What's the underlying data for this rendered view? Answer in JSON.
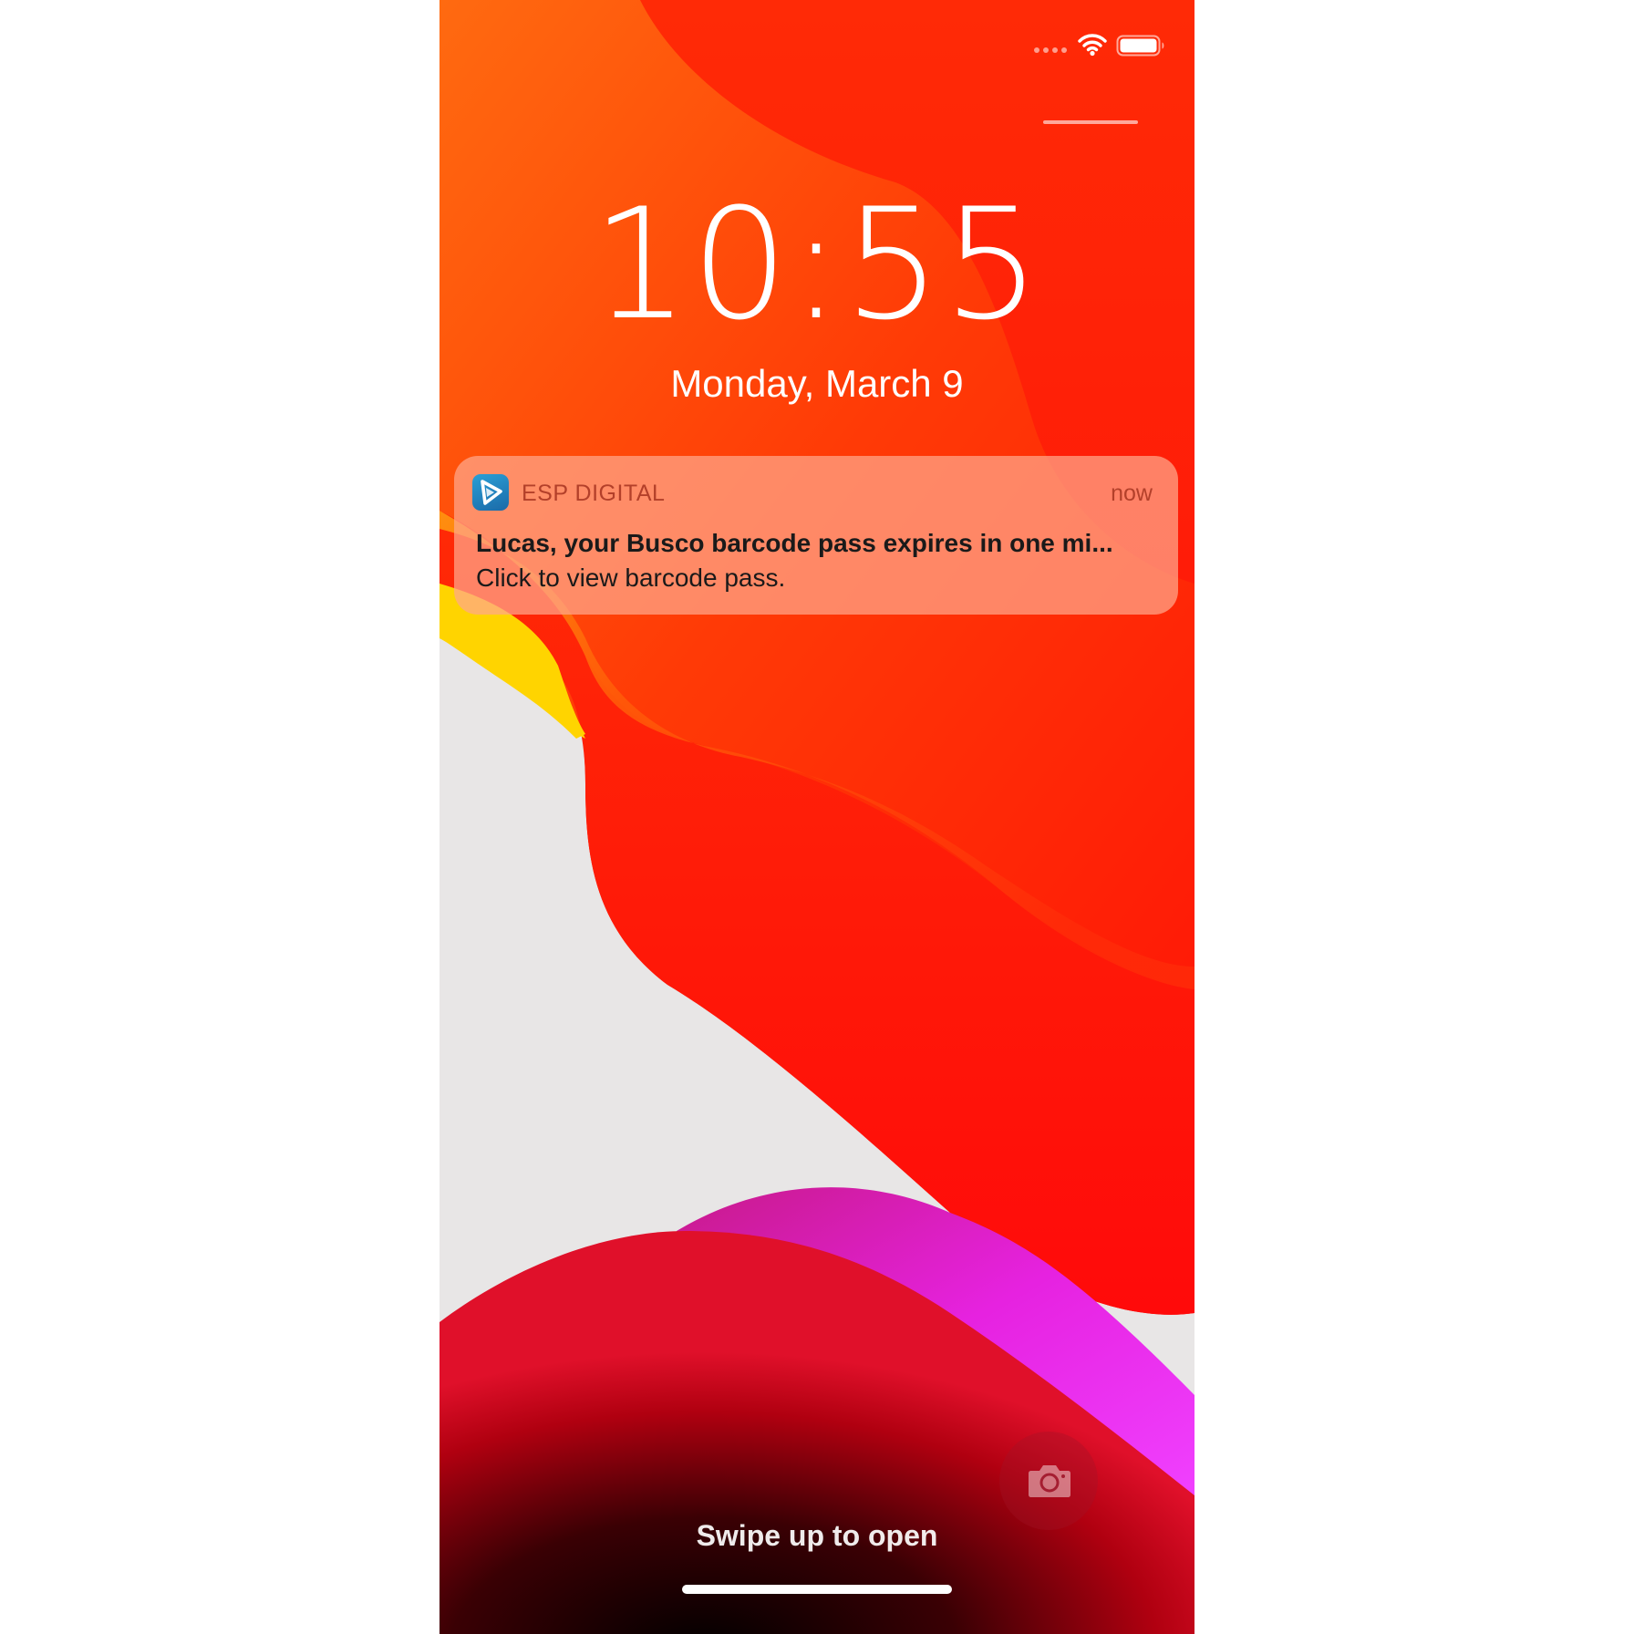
{
  "status_bar": {
    "signal_icon": "signal-dots-icon",
    "wifi_icon": "wifi-icon",
    "battery_icon": "battery-icon"
  },
  "lock_screen": {
    "time": "10:55",
    "date": "Monday, March 9"
  },
  "notification": {
    "app_icon": "esp-digital-app-icon",
    "app_name": "ESP DIGITAL",
    "time_ago": "now",
    "title": "Lucas, your Busco barcode pass expires in one mi...",
    "body": "Click to view barcode pass."
  },
  "camera": {
    "icon": "camera-icon"
  },
  "footer": {
    "swipe_label": "Swipe up to open"
  },
  "colors": {
    "notification_meta_text": "#b3402a",
    "notification_bg": "#ffa88c",
    "wallpaper_red": "#ff1a0a",
    "wallpaper_orange": "#ff4e0e",
    "wallpaper_yellow": "#ffd400",
    "wallpaper_magenta": "#f02cf0",
    "wallpaper_gray": "#e8e6e6"
  }
}
